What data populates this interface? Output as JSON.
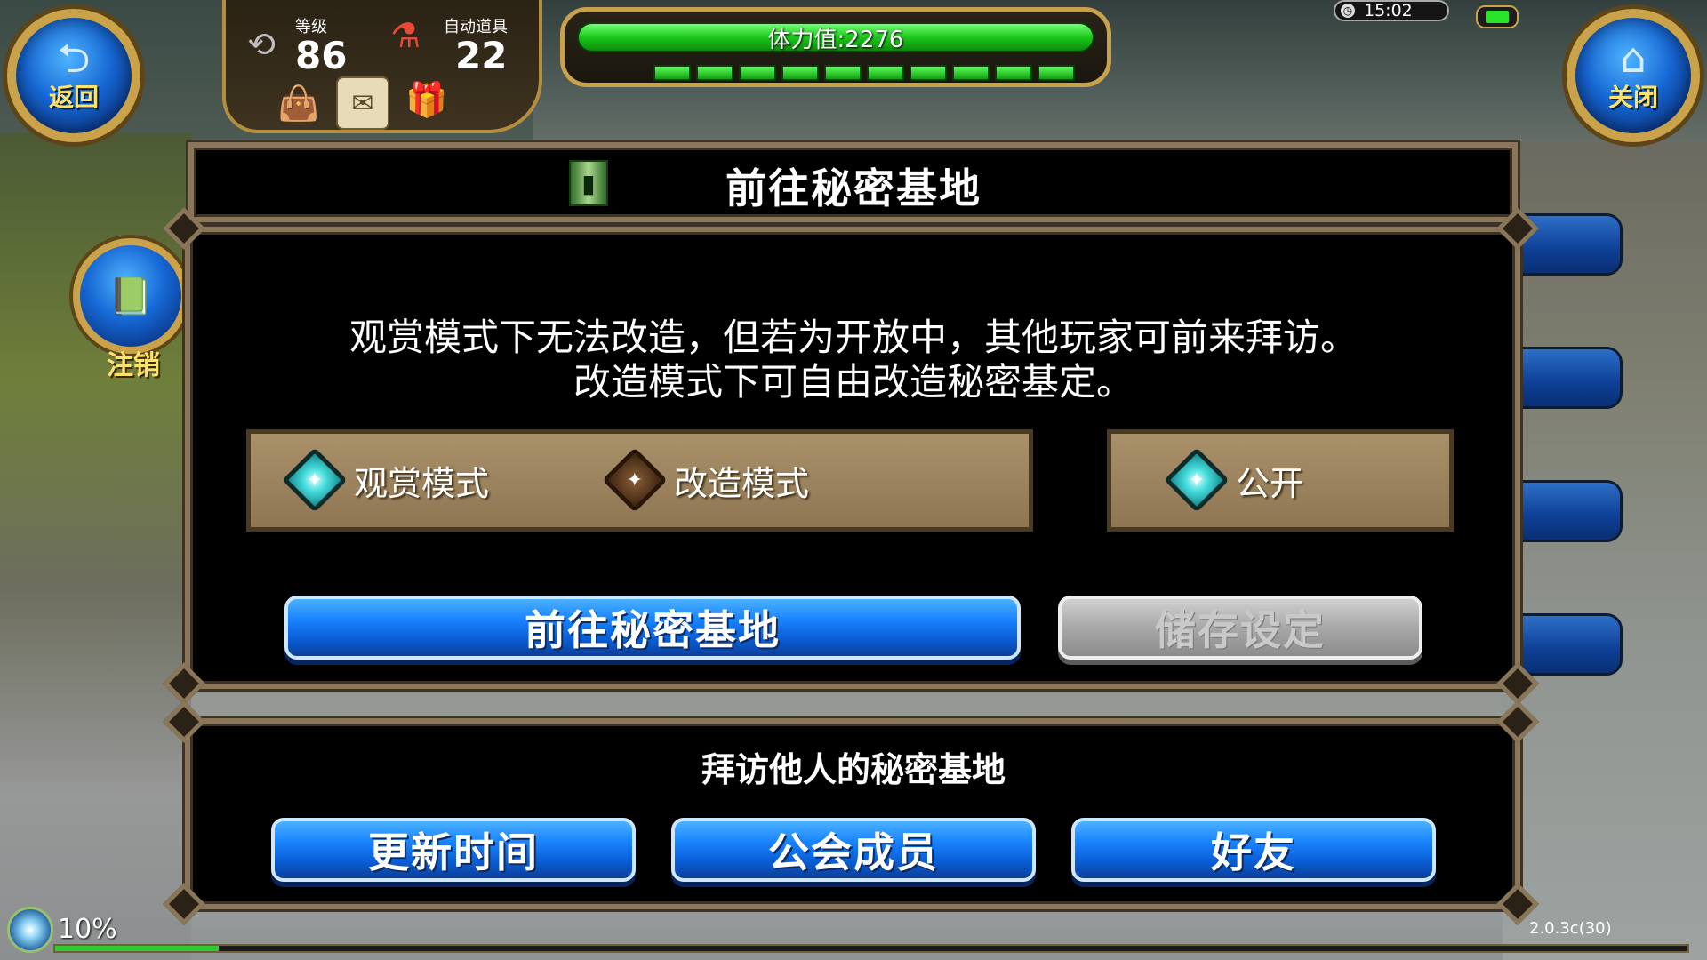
{
  "hud": {
    "back_label": "返回",
    "close_label": "关闭",
    "level_label": "等级",
    "level_value": "86",
    "auto_item_label": "自动道具",
    "auto_item_value": "22",
    "stamina_text": "体力值:2276",
    "stamina_segments": 10,
    "clock_time": "15:02"
  },
  "sidebar": {
    "logout_label": "注销"
  },
  "dialog": {
    "title": "前往秘密基地",
    "description_line1": "观赏模式下无法改造，但若为开放中，其他玩家可前来拜访。",
    "description_line2": "改造模式下可自由改造秘密基定。",
    "modes": [
      {
        "label": "观赏模式",
        "selected": true
      },
      {
        "label": "改造模式",
        "selected": false
      }
    ],
    "public_option": {
      "label": "公开",
      "selected": true
    },
    "go_button": "前往秘密基地",
    "save_button": "储存设定"
  },
  "visit": {
    "title": "拜访他人的秘密基地",
    "buttons": [
      "更新时间",
      "公会成员",
      "好友"
    ]
  },
  "footer": {
    "exp_text": "10%",
    "exp_fraction": 0.1,
    "version": "2.0.3c(30)"
  },
  "colors": {
    "button_blue": "#1a84ff",
    "button_gray": "#a8a8a8",
    "panel_border": "#8a7658",
    "stamina_green": "#1bc81b",
    "gold_frame": "#c9a24a"
  }
}
